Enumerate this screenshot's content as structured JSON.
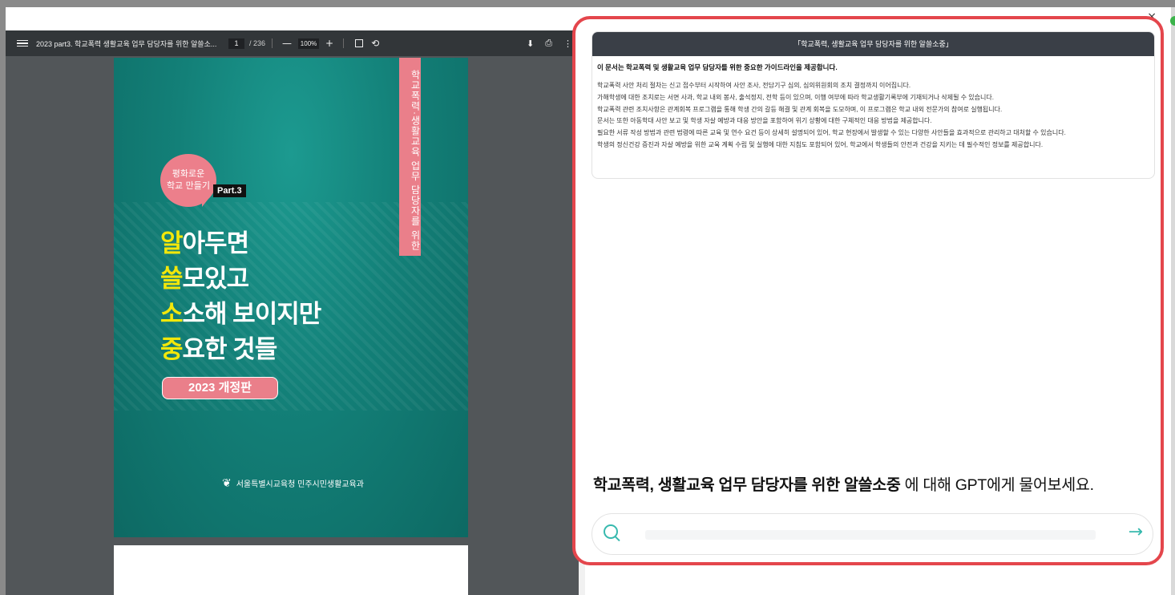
{
  "window": {
    "close_label": "×"
  },
  "pdf": {
    "title": "2023 part3. 학교폭력 생활교육 업무 담당자를 위한 알쓸소...",
    "page_current": "1",
    "page_total": "/ 236",
    "zoom_minus": "—",
    "zoom": "100%",
    "zoom_plus": "+",
    "fit_icon": "fit-page-icon",
    "rotate_label": "⟲",
    "download_label": "⬇",
    "print_label": "⎙",
    "more_label": "⋮"
  },
  "cover": {
    "vertical_title": "학교폭력·생활교육 업무 담당자를 위한",
    "bubble_line1": "평화로운",
    "bubble_line2": "학교 만들기",
    "part": "Part.3",
    "lines": [
      {
        "lead": "알",
        "rest": "아두면"
      },
      {
        "lead": "쓸",
        "rest": "모있고"
      },
      {
        "lead": "소",
        "rest": "소해 보이지만"
      },
      {
        "lead": "중",
        "rest": "요한 것들"
      }
    ],
    "edition": "2023 개정판",
    "publisher": "서울특별시교육청 민주시민생활교육과",
    "accent_yellow": "#f2e70b",
    "accent_pink": "#ea7f8a",
    "teal": "#138078"
  },
  "chat": {
    "summary_title": "「학교폭력, 생활교육 업무 담당자를 위한 알쓸소중」",
    "summary_lead": "이 문서는 학교폭력 및 생활교육 업무 담당자를 위한 중요한 가이드라인을 제공합니다.",
    "summary_lines": [
      "학교폭력 사안 처리 절차는 신고 접수부터 시작하여 사안 조사, 전담기구 심의, 심의위원회의 조치 결정까지 이어집니다.",
      "가해학생에 대한 조치로는 서면 사과, 학교 내외 봉사, 출석정지, 전학 등이 있으며, 이행 여부에 따라 학교생활기록부에 기재되거나 삭제될 수 있습니다.",
      "학교폭력 관련 조치사항은 관계회복 프로그램을 통해 학생 간의 갈등 해결 및 관계 회복을 도모하며, 이 프로그램은 학교 내외 전문가의 참여로 실행됩니다.",
      "문서는 또한 아동학대 사안 보고 및 학생 자살 예방과 대응 방안을 포함하여 위기 상황에 대한 구체적인 대응 방법을 제공합니다.",
      "필요한 서류 작성 방법과 관련 법령에 따른 교육 및 연수 요건 등이 상세히 설명되어 있어, 학교 현장에서 발생할 수 있는 다양한 사안들을 효과적으로 관리하고 대처할 수 있습니다.",
      "학생의 정신건강 증진과 자살 예방을 위한 교육 계획 수립 및 실행에 대한 지침도 포함되어 있어, 학교에서 학생들의 안전과 건강을 지키는 데 필수적인 정보를 제공합니다."
    ],
    "prompt_bold": "학교폭력, 생활교육 업무 담당자를 위한 알쓸소중",
    "prompt_rest": " 에 대해 GPT에게 물어보세요.",
    "input_value": "",
    "send_label": "→",
    "highlight_color": "#e4464c",
    "accent_color": "#37b9ae"
  }
}
